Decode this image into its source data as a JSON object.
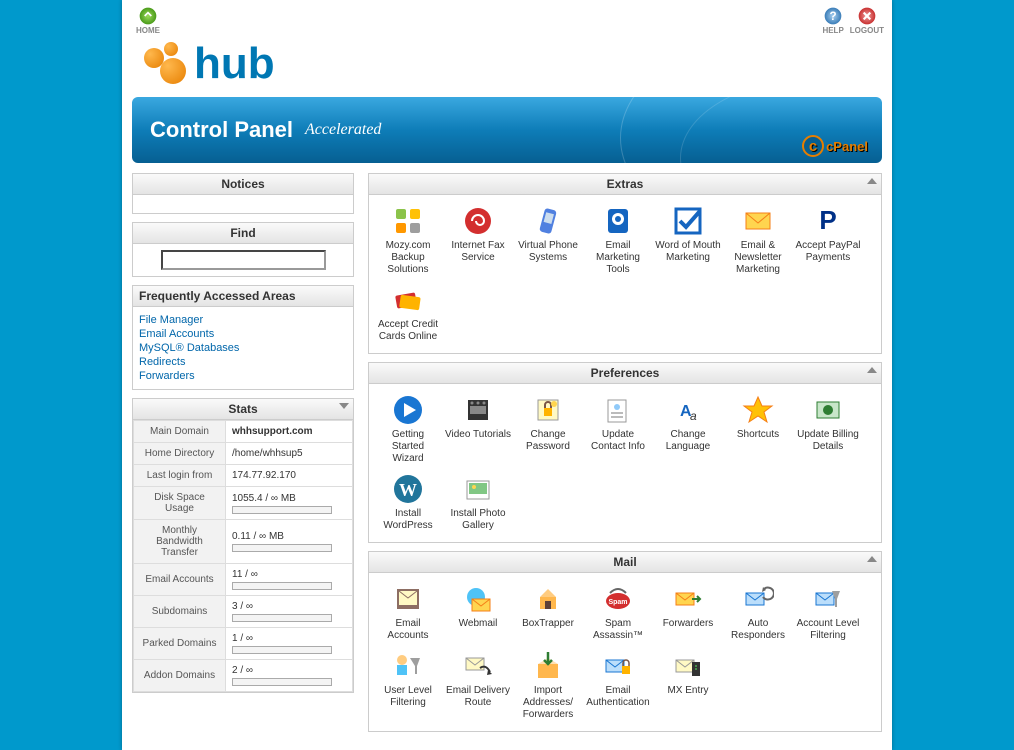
{
  "topbar": {
    "home": "HOME",
    "help": "HELP",
    "logout": "LOGOUT"
  },
  "logo": {
    "text": "hub"
  },
  "banner": {
    "title": "Control Panel",
    "subtitle": "Accelerated",
    "brand": "cPanel"
  },
  "sidebar": {
    "notices": {
      "title": "Notices"
    },
    "find": {
      "title": "Find"
    },
    "faa": {
      "title": "Frequently Accessed Areas",
      "items": [
        "File Manager",
        "Email Accounts",
        "MySQL® Databases",
        "Redirects",
        "Forwarders"
      ]
    },
    "stats": {
      "title": "Stats",
      "rows": [
        {
          "label": "Main Domain",
          "value": "whhsupport.com",
          "bold": true
        },
        {
          "label": "Home Directory",
          "value": "/home/whhsup5"
        },
        {
          "label": "Last login from",
          "value": "174.77.92.170"
        },
        {
          "label": "Disk Space Usage",
          "value": "1055.4 / ∞ MB",
          "bar": true
        },
        {
          "label": "Monthly Bandwidth Transfer",
          "value": "0.11 / ∞ MB",
          "bar": true
        },
        {
          "label": "Email Accounts",
          "value": "11 / ∞",
          "bar": true
        },
        {
          "label": "Subdomains",
          "value": "3 / ∞",
          "bar": true
        },
        {
          "label": "Parked Domains",
          "value": "1 / ∞",
          "bar": true
        },
        {
          "label": "Addon Domains",
          "value": "2 / ∞",
          "bar": true
        }
      ]
    }
  },
  "groups": [
    {
      "title": "Extras",
      "items": [
        {
          "name": "mozy-backup",
          "label": "Mozy.com Backup Solutions",
          "icon": "grid"
        },
        {
          "name": "internet-fax",
          "label": "Internet Fax Service",
          "icon": "swirl"
        },
        {
          "name": "virtual-phone",
          "label": "Virtual Phone Systems",
          "icon": "phone"
        },
        {
          "name": "email-marketing",
          "label": "Email Marketing Tools",
          "icon": "bullhorn"
        },
        {
          "name": "word-of-mouth",
          "label": "Word of Mouth Marketing",
          "icon": "check"
        },
        {
          "name": "newsletter",
          "label": "Email & Newsletter Marketing",
          "icon": "envelope"
        },
        {
          "name": "paypal",
          "label": "Accept PayPal Payments",
          "icon": "pp"
        },
        {
          "name": "credit-cards",
          "label": "Accept Credit Cards Online",
          "icon": "cards"
        }
      ]
    },
    {
      "title": "Preferences",
      "items": [
        {
          "name": "getting-started",
          "label": "Getting Started Wizard",
          "icon": "play"
        },
        {
          "name": "video-tutorials",
          "label": "Video Tutorials",
          "icon": "film"
        },
        {
          "name": "change-password",
          "label": "Change Password",
          "icon": "lock"
        },
        {
          "name": "update-contact",
          "label": "Update Contact Info",
          "icon": "contact"
        },
        {
          "name": "change-language",
          "label": "Change Language",
          "icon": "lang"
        },
        {
          "name": "shortcuts",
          "label": "Shortcuts",
          "icon": "star"
        },
        {
          "name": "billing",
          "label": "Update Billing Details",
          "icon": "money"
        },
        {
          "name": "wordpress",
          "label": "Install WordPress",
          "icon": "wp"
        },
        {
          "name": "photo-gallery",
          "label": "Install Photo Gallery",
          "icon": "photo"
        }
      ]
    },
    {
      "title": "Mail",
      "items": [
        {
          "name": "email-accounts",
          "label": "Email Accounts",
          "icon": "mailbook"
        },
        {
          "name": "webmail",
          "label": "Webmail",
          "icon": "webmail"
        },
        {
          "name": "boxtrapper",
          "label": "BoxTrapper",
          "icon": "trap"
        },
        {
          "name": "spam-assassin",
          "label": "Spam Assassin™",
          "icon": "spam"
        },
        {
          "name": "forwarders",
          "label": "Forwarders",
          "icon": "fwd"
        },
        {
          "name": "auto-responders",
          "label": "Auto Responders",
          "icon": "auto"
        },
        {
          "name": "account-filtering",
          "label": "Account Level Filtering",
          "icon": "filter-a"
        },
        {
          "name": "user-filtering",
          "label": "User Level Filtering",
          "icon": "filter-u"
        },
        {
          "name": "delivery-route",
          "label": "Email Delivery Route",
          "icon": "route"
        },
        {
          "name": "import-addresses",
          "label": "Import Addresses/ Forwarders",
          "icon": "import"
        },
        {
          "name": "email-auth",
          "label": "Email Authentication",
          "icon": "auth"
        },
        {
          "name": "mx-entry",
          "label": "MX Entry",
          "icon": "mx"
        }
      ]
    }
  ]
}
